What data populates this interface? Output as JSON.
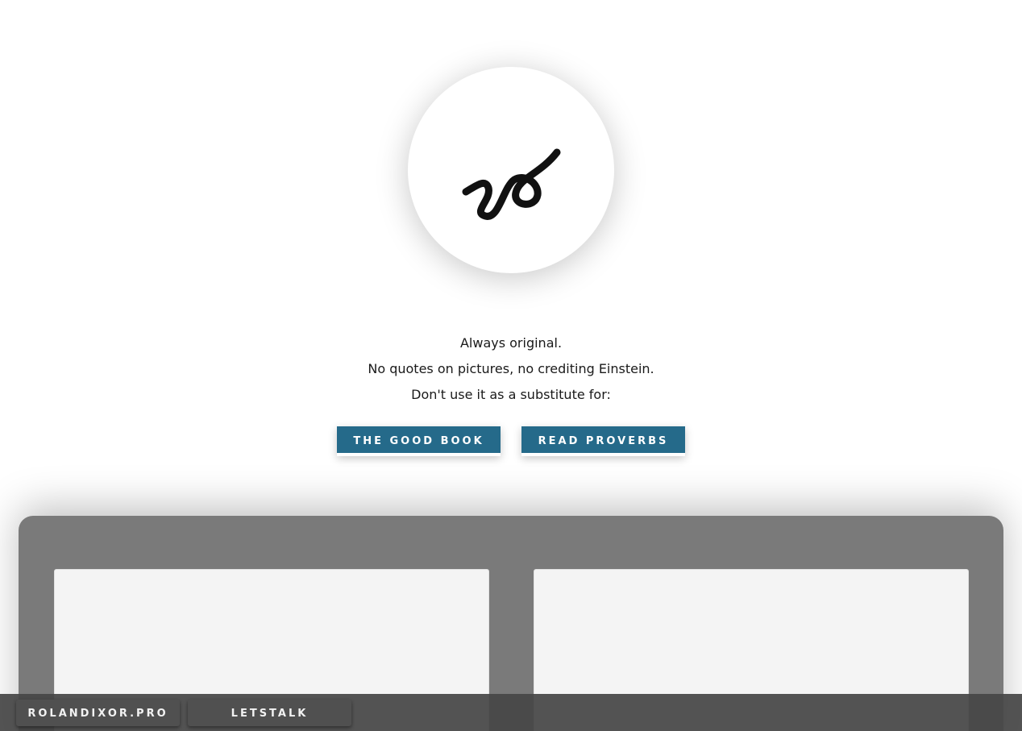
{
  "logo": {
    "icon": "signature-logo-icon",
    "stroke_color": "#111111"
  },
  "taglines": [
    "Always original.",
    "No quotes on pictures, no crediting Einstein.",
    "Don't use it as a substitute for:"
  ],
  "cta_buttons": [
    {
      "label": "THE GOOD BOOK"
    },
    {
      "label": "READ PROVERBS"
    }
  ],
  "bottom_bar": {
    "buttons": [
      {
        "label": "ROLANDIXOR.PRO"
      },
      {
        "label": "LETSTALK"
      }
    ]
  },
  "colors": {
    "accent": "#256a8a",
    "panel": "#7a7a7a",
    "bar": "#464646"
  }
}
